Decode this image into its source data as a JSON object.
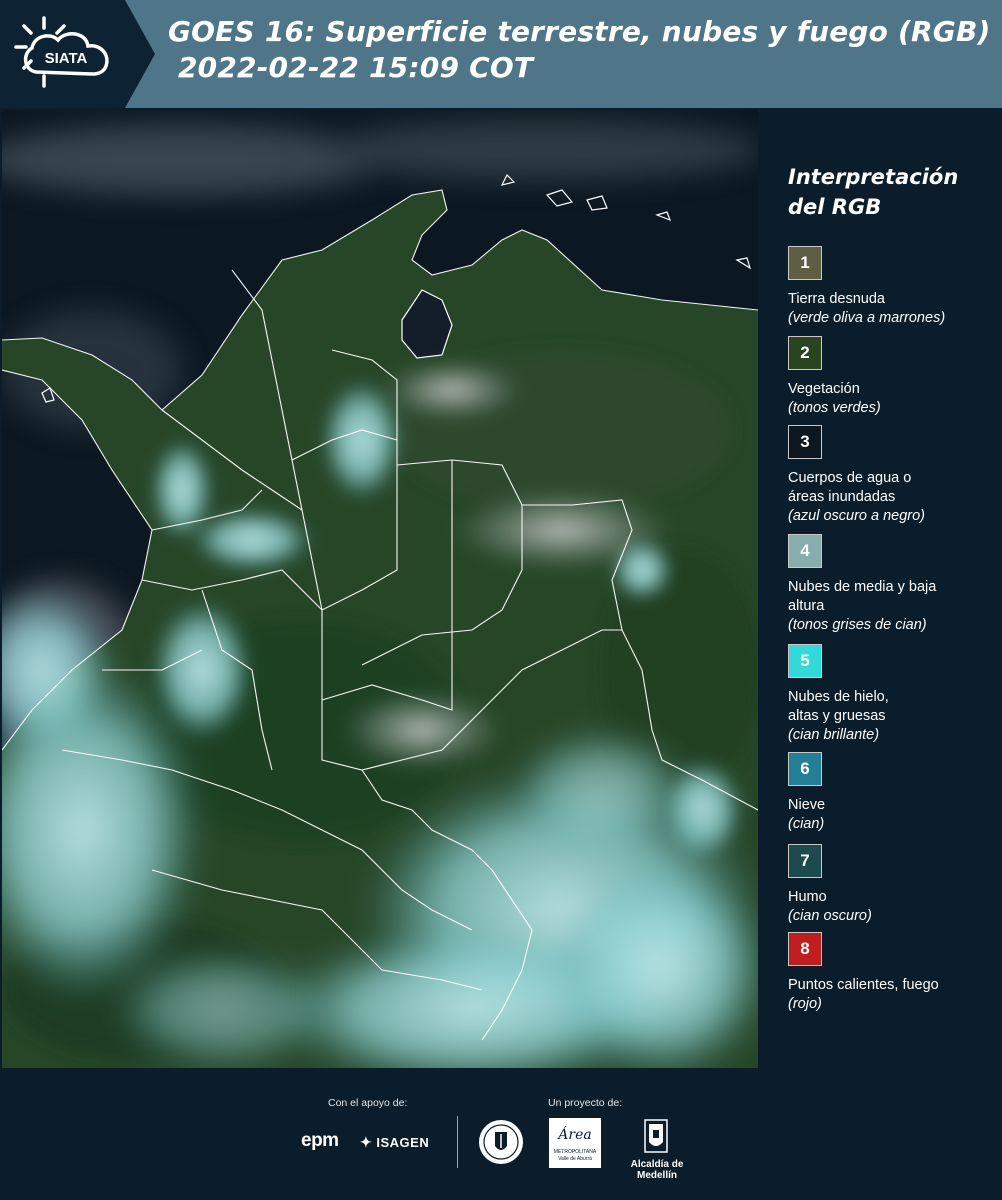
{
  "header": {
    "logo_text": "SIATA",
    "title_line1": "GOES 16: Superficie terrestre, nubes y fuego (RGB)",
    "title_line2": "2022-02-22 15:09 COT",
    "colors": {
      "band": "#4e7688",
      "dark": "#0d2333"
    }
  },
  "map": {
    "description_icon": "satellite-rgb-map",
    "colors": {
      "ocean": "#0c1821",
      "land": "#2a4a2c",
      "cloud": "#9edcdc",
      "border": "#ffffff"
    }
  },
  "legend": {
    "title": "Interpretación del RGB",
    "items": [
      {
        "number": "1",
        "label": "Tierra desnuda",
        "hint": "(verde oliva a marrones)",
        "color": "#5f5e42"
      },
      {
        "number": "2",
        "label": "Vegetación",
        "hint": "(tonos verdes)",
        "color": "#2b4420"
      },
      {
        "number": "3",
        "label": "Cuerpos de agua o áreas inundadas",
        "hint": "(azul oscuro a negro)",
        "color": "#0c1720"
      },
      {
        "number": "4",
        "label": "Nubes de media y baja altura",
        "hint": "(tonos grises de cian)",
        "color": "#88adac"
      },
      {
        "number": "5",
        "label": "Nubes de hielo, altas y gruesas",
        "hint": "(cian brillante)",
        "color": "#33d8d8"
      },
      {
        "number": "6",
        "label": "Nieve",
        "hint": "(cian)",
        "color": "#237f96"
      },
      {
        "number": "7",
        "label": "Humo",
        "hint": "(cian oscuro)",
        "color": "#1c4a4d"
      },
      {
        "number": "8",
        "label": "Puntos calientes, fuego",
        "hint": "(rojo)",
        "color": "#c01e1e"
      }
    ]
  },
  "footer": {
    "support_label": "Con el apoyo de:",
    "project_label": "Un proyecto de:",
    "sponsors": [
      "epm",
      "ISAGEN"
    ],
    "partners_alcaldia": "Alcaldía de Medellín",
    "partners_area": "Área",
    "partners_area_sub": "METROPOLITANA",
    "partners_area_sub2": "Valle de Aburrá"
  }
}
